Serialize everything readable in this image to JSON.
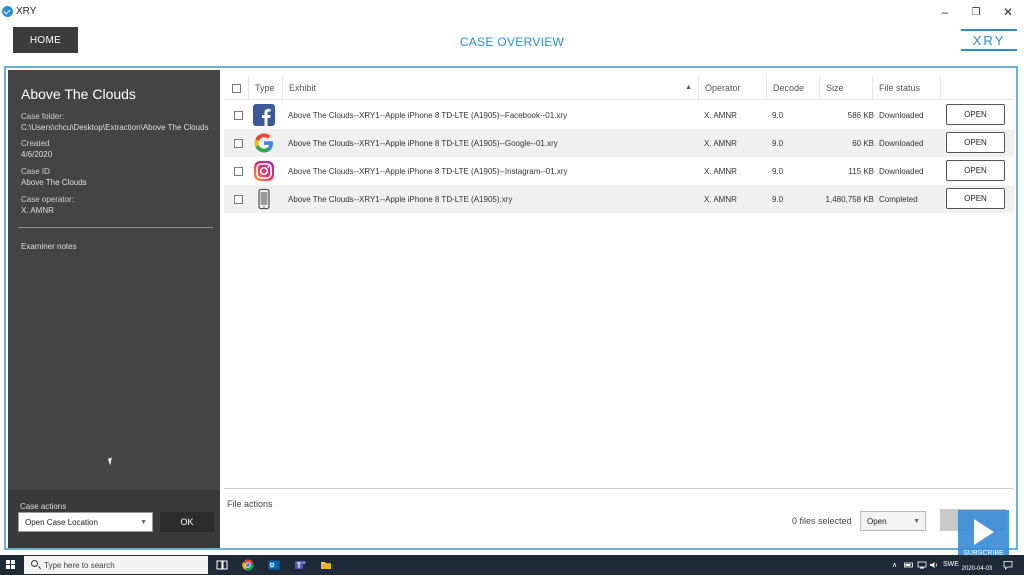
{
  "window": {
    "title": "XRY",
    "minimize": "–",
    "restore": "❐",
    "close": "✕"
  },
  "header": {
    "home_label": "HOME",
    "page_title": "CASE OVERVIEW",
    "logo": "XRY"
  },
  "case": {
    "name": "Above The Clouds",
    "folder_label": "Case folder:",
    "folder_value": "C:\\Users\\chcu\\Desktop\\Extraction\\Above The Clouds",
    "created_label": "Created",
    "created_value": "4/6/2020",
    "id_label": "Case ID",
    "id_value": "Above The Clouds",
    "operator_label": "Case operator:",
    "operator_value": "X. AMNR",
    "notes_label": "Examiner notes",
    "actions_label": "Case actions",
    "actions_select": "Open Case Location",
    "ok_label": "OK"
  },
  "table": {
    "columns": [
      "Type",
      "Exhibit",
      "Operator",
      "Decode",
      "Size",
      "File status"
    ],
    "rows": [
      {
        "icon": "facebook-icon",
        "exhibit": "Above The Clouds--XRY1--Apple iPhone 8 TD-LTE (A1905)--Facebook--01.xry",
        "operator": "X. AMNR",
        "decode": "9.0",
        "size": "586 KB",
        "status": "Downloaded",
        "action": "OPEN"
      },
      {
        "icon": "google-icon",
        "exhibit": "Above The Clouds--XRY1--Apple iPhone 8 TD-LTE (A1905)--Google--01.xry",
        "operator": "X. AMNR",
        "decode": "9.0",
        "size": "60 KB",
        "status": "Downloaded",
        "action": "OPEN"
      },
      {
        "icon": "instagram-icon",
        "exhibit": "Above The Clouds--XRY1--Apple iPhone 8 TD-LTE (A1905)--Instagram--01.xry",
        "operator": "X. AMNR",
        "decode": "9.0",
        "size": "115 KB",
        "status": "Downloaded",
        "action": "OPEN"
      },
      {
        "icon": "phone-icon",
        "exhibit": "Above The Clouds--XRY1--Apple iPhone 8 TD-LTE (A1905).xry",
        "operator": "X. AMNR",
        "decode": "9.0",
        "size": "1,480,758 KB",
        "status": "Completed",
        "action": "OPEN"
      }
    ]
  },
  "file_actions": {
    "label": "File actions",
    "selected_text": "0 files selected",
    "select_value": "Open"
  },
  "overlay": {
    "subscribe": "SUBSCRIBE"
  },
  "taskbar": {
    "search_placeholder": "Type here to search",
    "lang": "SWE",
    "date": "2020-04-03"
  },
  "colors": {
    "accent": "#2a8fc4",
    "panel": "#444444",
    "frame": "#6ab0d8"
  }
}
